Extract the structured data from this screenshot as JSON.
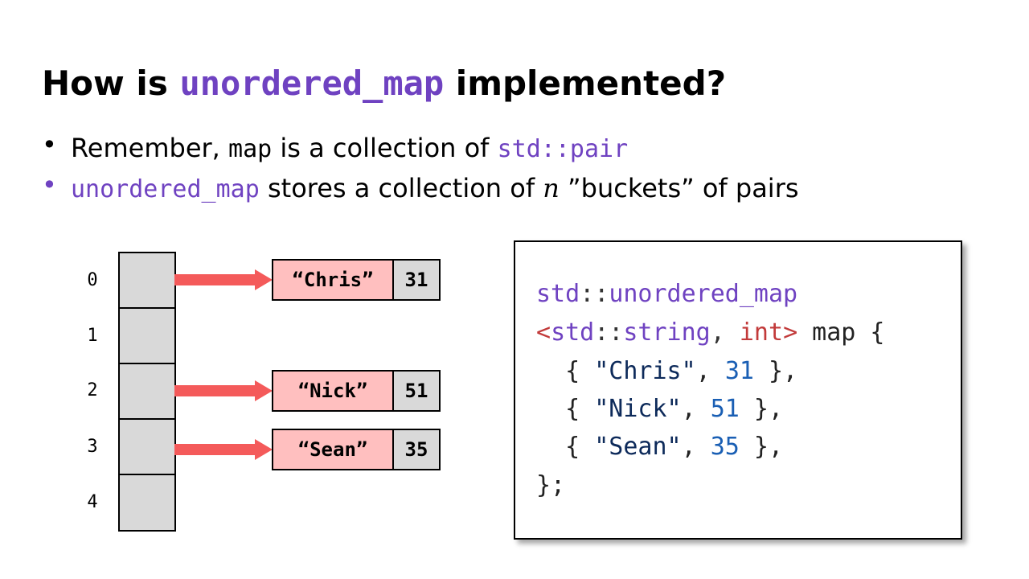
{
  "title": {
    "prefix": "How is ",
    "code": "unordered_map",
    "suffix": " implemented?"
  },
  "bullets": [
    {
      "dot": "•",
      "dot_color": "#000000",
      "parts": [
        "Remember, ",
        "map",
        " is a collection of ",
        "std::pair"
      ]
    },
    {
      "dot": "•",
      "dot_color": "#6f42c1",
      "parts": [
        "unordered_map",
        " stores a collection of ",
        "n",
        " ”buckets” of pairs"
      ]
    }
  ],
  "diagram": {
    "indices": [
      "0",
      "1",
      "2",
      "3",
      "4"
    ],
    "entries": [
      {
        "bucket": "0",
        "key": "“Chris”",
        "value": "31"
      },
      {
        "bucket": "2",
        "key": "“Nick”",
        "value": "51"
      },
      {
        "bucket": "3",
        "key": "“Sean”",
        "value": "35"
      }
    ],
    "colors": {
      "bucket_fill": "#d9d9d9",
      "key_fill": "#ffbfbf",
      "arrow": "#f45a5a"
    }
  },
  "code": {
    "line1": {
      "ns": "std",
      "sep": "::",
      "name": "unordered_map"
    },
    "line2": {
      "open": "<",
      "ns": "std",
      "sep": "::",
      "type": "string",
      "comma": ", ",
      "int": "int",
      "close": ">",
      "rest": " map {"
    },
    "entries": [
      {
        "open": "  { ",
        "key": "\"Chris\"",
        "comma": ", ",
        "value": "31",
        "close": " },"
      },
      {
        "open": "  { ",
        "key": "\"Nick\"",
        "comma": ", ",
        "value": "51",
        "close": " },"
      },
      {
        "open": "  { ",
        "key": "\"Sean\"",
        "comma": ", ",
        "value": "35",
        "close": " },"
      }
    ],
    "last_line": "};"
  }
}
